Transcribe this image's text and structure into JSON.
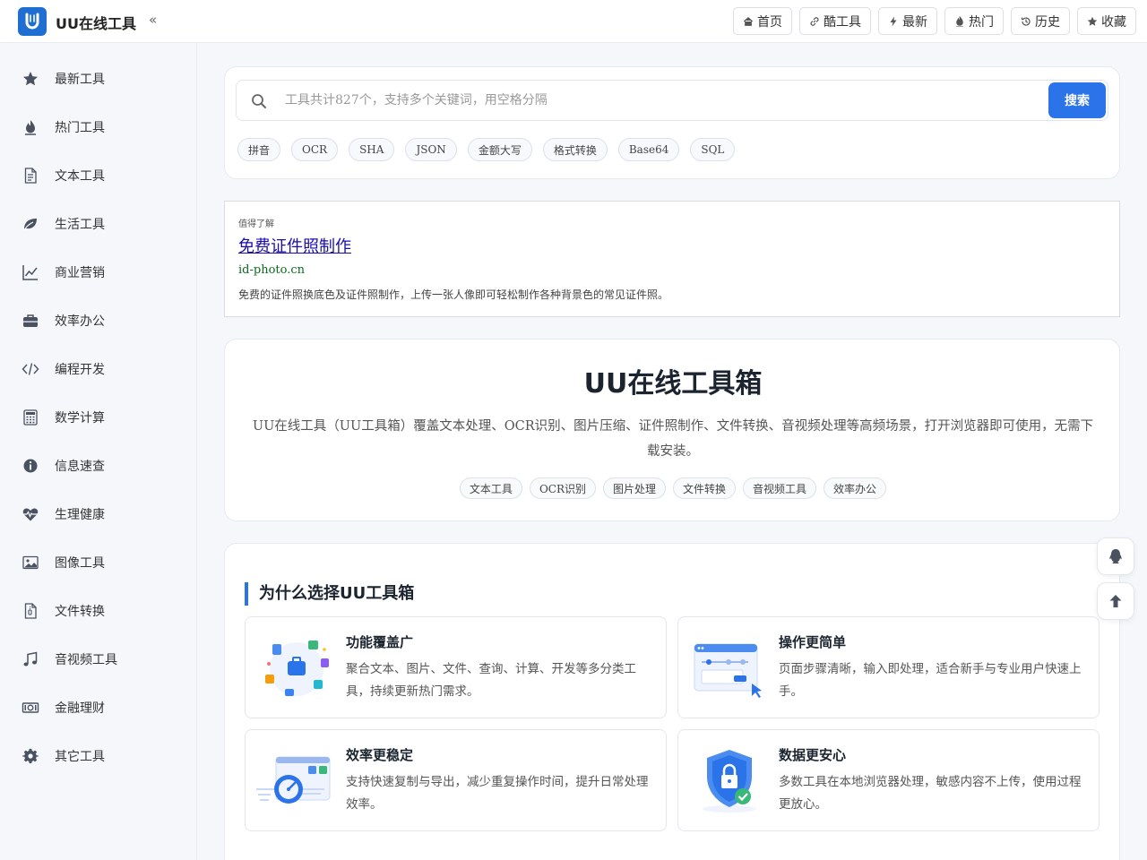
{
  "header": {
    "brand": "UU在线工具",
    "collapse": "«",
    "nav": [
      {
        "label": "首页",
        "icon": "home-icon"
      },
      {
        "label": "酷工具",
        "icon": "link-icon"
      },
      {
        "label": "最新",
        "icon": "bolt-icon"
      },
      {
        "label": "热门",
        "icon": "fire-icon"
      },
      {
        "label": "历史",
        "icon": "history-icon"
      },
      {
        "label": "收藏",
        "icon": "star-icon"
      }
    ]
  },
  "sidebar": {
    "items": [
      {
        "label": "最新工具",
        "icon": "star-icon"
      },
      {
        "label": "热门工具",
        "icon": "fire-icon"
      },
      {
        "label": "文本工具",
        "icon": "document-icon"
      },
      {
        "label": "生活工具",
        "icon": "leaf-icon"
      },
      {
        "label": "商业营销",
        "icon": "chart-line-icon"
      },
      {
        "label": "效率办公",
        "icon": "briefcase-icon"
      },
      {
        "label": "编程开发",
        "icon": "code-icon"
      },
      {
        "label": "数学计算",
        "icon": "calculator-icon"
      },
      {
        "label": "信息速查",
        "icon": "info-icon"
      },
      {
        "label": "生理健康",
        "icon": "heartbeat-icon"
      },
      {
        "label": "图像工具",
        "icon": "image-icon"
      },
      {
        "label": "文件转换",
        "icon": "file-icon"
      },
      {
        "label": "音视频工具",
        "icon": "music-icon"
      },
      {
        "label": "金融理财",
        "icon": "money-icon"
      },
      {
        "label": "其它工具",
        "icon": "gear-icon"
      }
    ]
  },
  "search": {
    "placeholder": "工具共计827个，支持多个关键词，用空格分隔",
    "button": "搜索",
    "tags": [
      "拼音",
      "OCR",
      "SHA",
      "JSON",
      "金额大写",
      "格式转换",
      "Base64",
      "SQL"
    ]
  },
  "ad": {
    "label": "值得了解",
    "title": "免费证件照制作",
    "url": "id-photo.cn",
    "desc": "免费的证件照换底色及证件照制作，上传一张人像即可轻松制作各种背景色的常见证件照。"
  },
  "intro": {
    "title": "UU在线工具箱",
    "desc": "UU在线工具（UU工具箱）覆盖文本处理、OCR识别、图片压缩、证件照制作、文件转换、音视频处理等高频场景，打开浏览器即可使用，无需下载安装。",
    "tags": [
      "文本工具",
      "OCR识别",
      "图片处理",
      "文件转换",
      "音视频工具",
      "效率办公"
    ]
  },
  "why": {
    "title": "为什么选择UU工具箱",
    "features": [
      {
        "title": "功能覆盖广",
        "desc": "聚合文本、图片、文件、查询、计算、开发等多分类工具，持续更新热门需求。"
      },
      {
        "title": "操作更简单",
        "desc": "页面步骤清晰，输入即处理，适合新手与专业用户快速上手。"
      },
      {
        "title": "效率更稳定",
        "desc": "支持快速复制与导出，减少重复操作时间，提升日常处理效率。"
      },
      {
        "title": "数据更安心",
        "desc": "多数工具在本地浏览器处理，敏感内容不上传，使用过程更放心。"
      }
    ]
  },
  "colors": {
    "accent": "#2a73e8",
    "ad_title": "#1a0dab",
    "ad_url": "#0b6b1e"
  }
}
